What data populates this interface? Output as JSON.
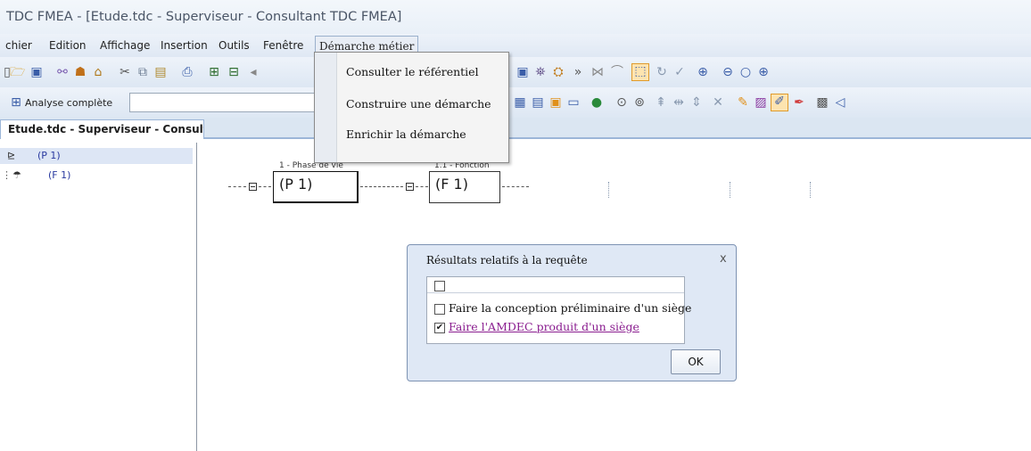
{
  "window": {
    "title": "TDC FMEA - [Etude.tdc - Superviseur - Consultant TDC FMEA]"
  },
  "menubar": {
    "items": [
      "chier",
      "Edition",
      "Affichage",
      "Insertion",
      "Outils",
      "Fenêtre",
      "Démarche métier"
    ]
  },
  "toolbar2": {
    "analyse_label": "Analyse complète",
    "combo_value": ""
  },
  "document_tab": {
    "label": "Etude.tdc - Superviseur - Consult..."
  },
  "tree": {
    "items": [
      {
        "label": "(P 1)",
        "selected": true
      },
      {
        "label": "(F 1)",
        "selected": false
      }
    ]
  },
  "diagram": {
    "nodes": [
      {
        "caption": "1 - Phase de vie",
        "label": "(P 1)"
      },
      {
        "caption": "1.1 - Fonction",
        "label": "(F 1)"
      }
    ]
  },
  "dropdown": {
    "items": [
      "Consulter le référentiel",
      "Construire une démarche",
      "Enrichir la démarche"
    ]
  },
  "dialog": {
    "title": "Résultats relatifs à la requête",
    "close": "x",
    "options": [
      {
        "label": "",
        "checked": false
      },
      {
        "label": "Faire la conception préliminaire d'un siège",
        "checked": false
      },
      {
        "label": "Faire l'AMDEC produit d'un siège",
        "checked": true
      }
    ],
    "ok_label": "OK"
  },
  "colors": {
    "link": "#8a1d8f",
    "selection": "#dde6f5",
    "chrome": "#dfe8f4"
  }
}
